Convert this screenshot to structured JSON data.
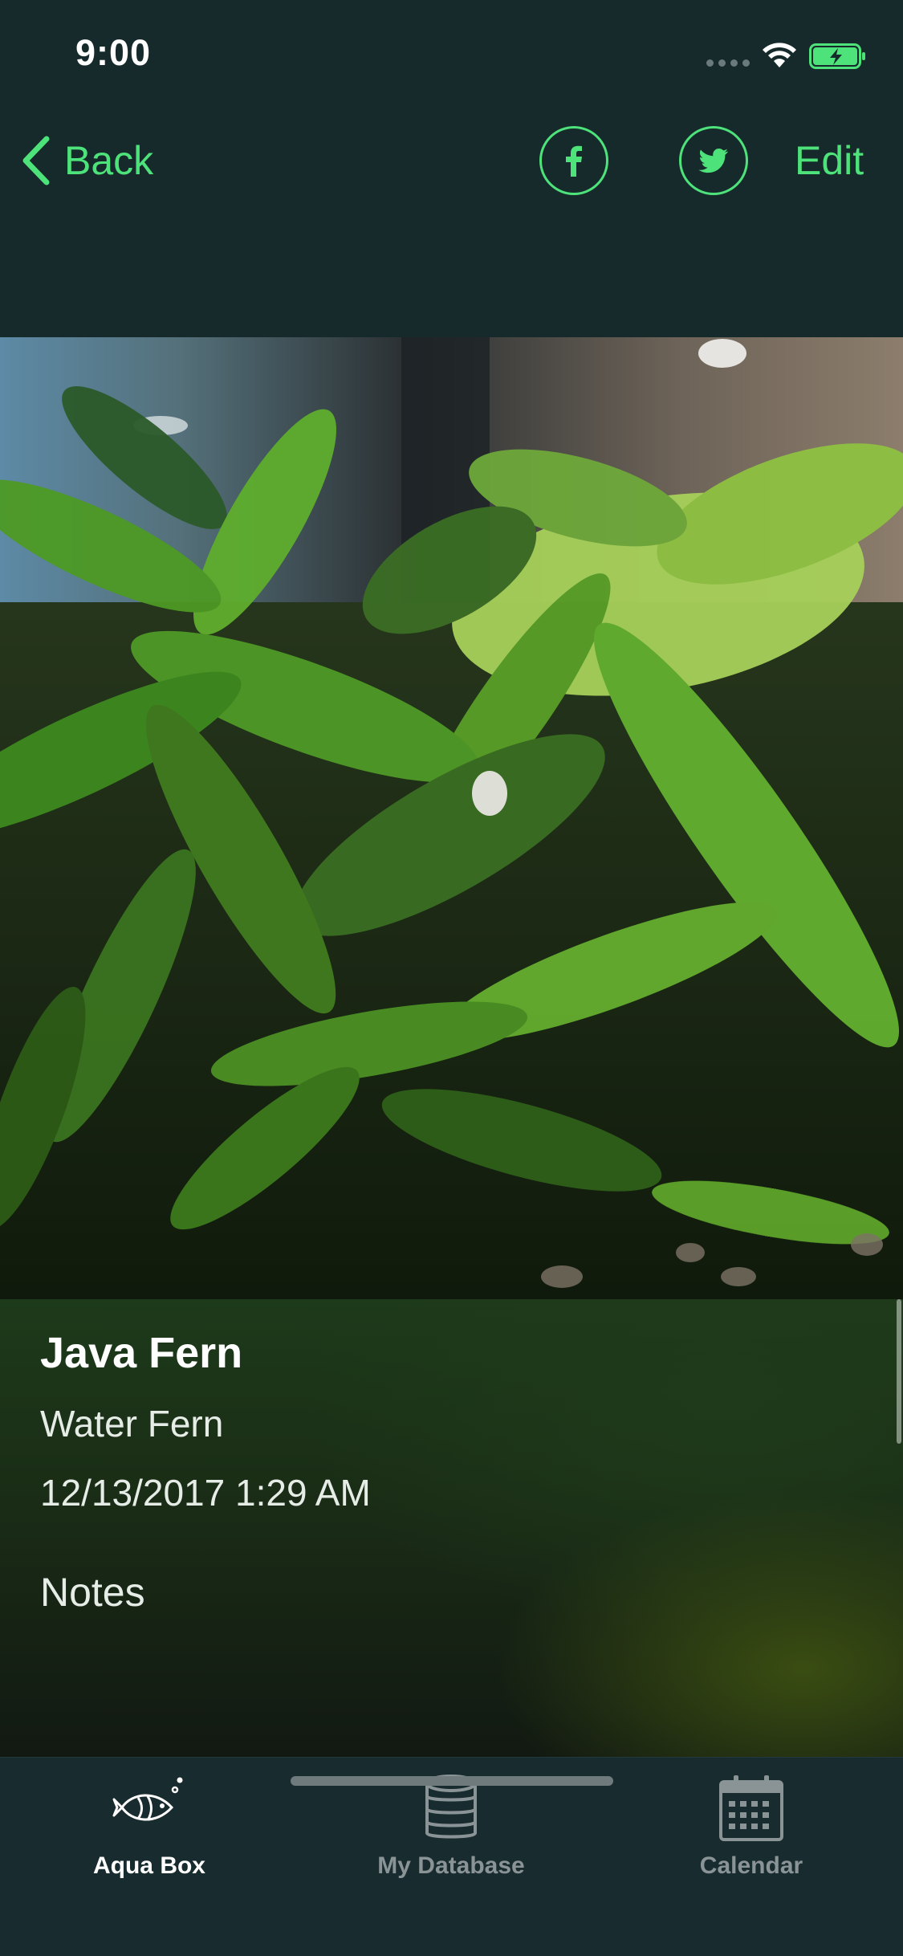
{
  "status_bar": {
    "time": "9:00"
  },
  "nav": {
    "back_label": "Back",
    "facebook_icon": "facebook-icon",
    "twitter_icon": "twitter-icon",
    "edit_label": "Edit",
    "accent_color": "#4ee27a"
  },
  "plant": {
    "name": "Java Fern",
    "common_name": "Water Fern",
    "date_added": "12/13/2017 1:29 AM",
    "notes_label": "Notes"
  },
  "tab_bar": {
    "tabs": [
      {
        "label": "Aqua Box",
        "icon": "fish-icon",
        "active": true
      },
      {
        "label": "My Database",
        "icon": "database-icon",
        "active": false
      },
      {
        "label": "Calendar",
        "icon": "calendar-icon",
        "active": false
      }
    ]
  }
}
